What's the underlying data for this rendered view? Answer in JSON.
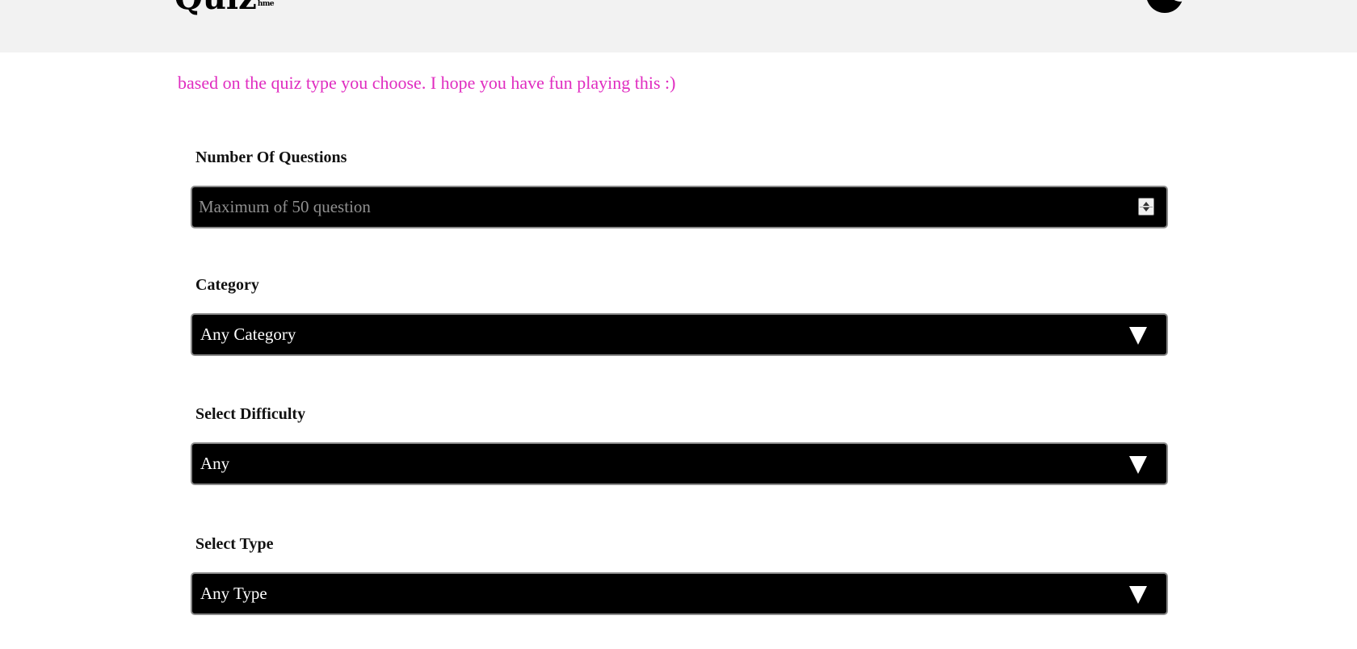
{
  "header": {
    "logo_main": "Quiz",
    "logo_sub": "hme",
    "theme_toggle_icon": "moon-icon"
  },
  "intro_text": "based on the quiz type you choose. I hope you have fun playing this :)",
  "form": {
    "questions": {
      "label": "Number Of Questions",
      "placeholder": "Maximum of 50 question",
      "value": ""
    },
    "category": {
      "label": "Category",
      "selected": "Any Category"
    },
    "difficulty": {
      "label": "Select Difficulty",
      "selected": "Any"
    },
    "type": {
      "label": "Select Type",
      "selected": "Any Type"
    }
  },
  "colors": {
    "header_bg": "#f2f2f2",
    "intro_text": "#e02cc0",
    "field_bg": "#000000",
    "field_border": "#8a8a8a"
  }
}
